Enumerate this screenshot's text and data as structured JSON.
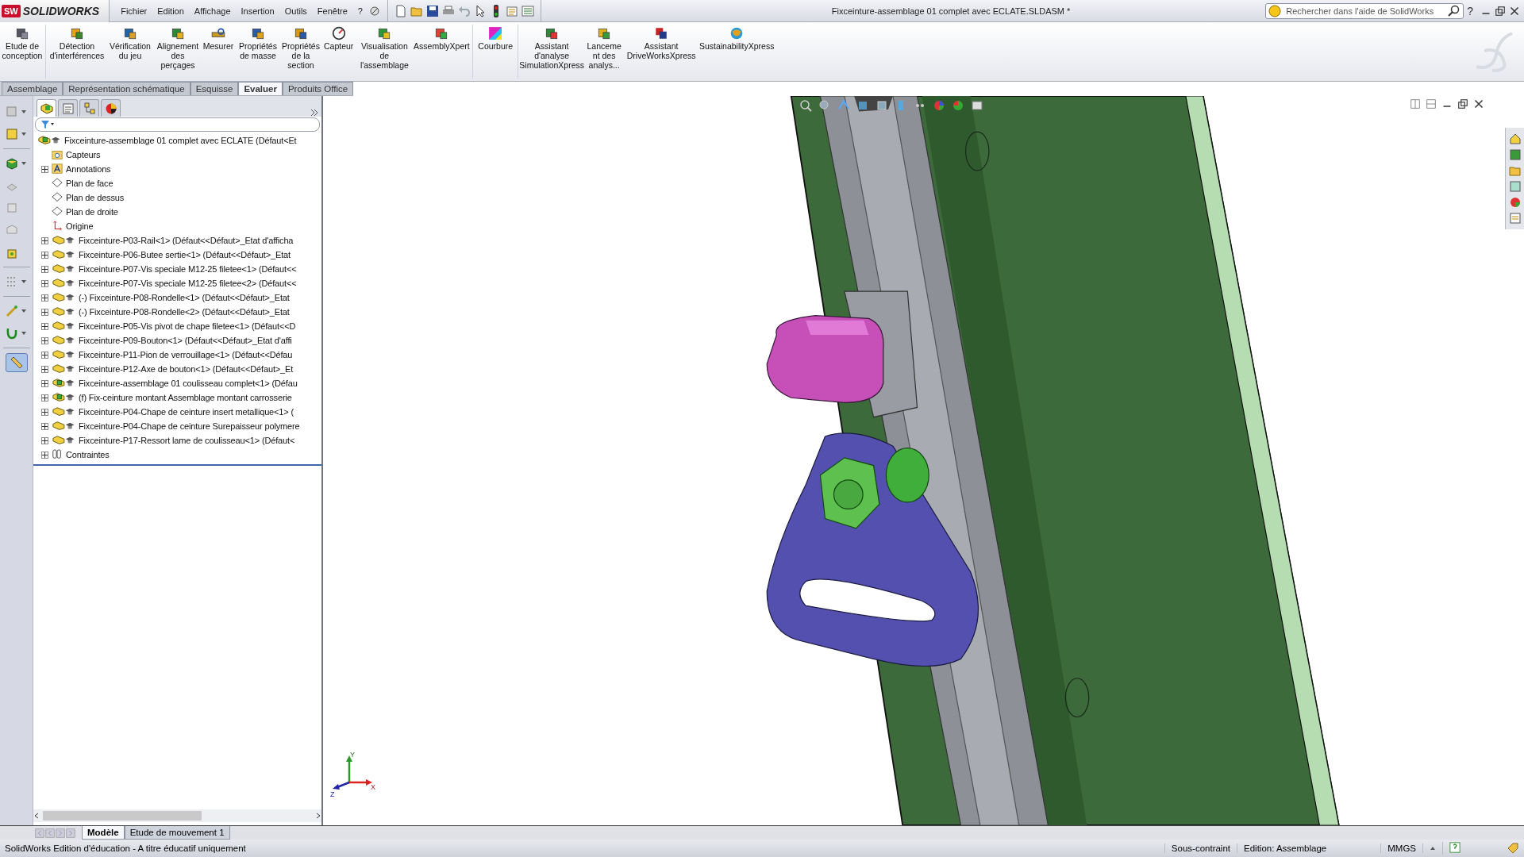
{
  "title_bar": {
    "logo_mark": "SW",
    "logo": "SOLIDWORKS",
    "menu": [
      "Fichier",
      "Edition",
      "Affichage",
      "Insertion",
      "Outils",
      "Fenêtre",
      "?"
    ],
    "document_title": "Fixceinture-assemblage 01 complet avec ECLATE.SLDASM *",
    "search": {
      "placeholder": "Rechercher dans l'aide de SolidWorks"
    },
    "help": "?"
  },
  "command_manager": [
    {
      "label": "Etude de conception",
      "kind": "design"
    },
    {
      "label": "Détection d'interférences",
      "kind": "interference"
    },
    {
      "label": "Vérification du jeu",
      "kind": "clearance"
    },
    {
      "label": "Alignement des perçages",
      "kind": "holes"
    },
    {
      "label": "Mesurer",
      "kind": "measure"
    },
    {
      "label": "Propriétés de masse",
      "kind": "mass"
    },
    {
      "label": "Propriétés de la section",
      "kind": "section"
    },
    {
      "label": "Capteur",
      "kind": "sensor"
    },
    {
      "label": "Visualisation de l'assemblage",
      "kind": "visualize"
    },
    {
      "label": "AssemblyXpert",
      "kind": "xpert"
    },
    {
      "label": "Courbure",
      "kind": "curvature"
    },
    {
      "label": "Assistant d'analyse SimulationXpress",
      "kind": "simulation"
    },
    {
      "label": "Lanceme nt des analys...",
      "kind": "launch"
    },
    {
      "label": "Assistant DriveWorksXpress",
      "kind": "driveworks"
    },
    {
      "label": "SustainabilityXpress",
      "kind": "sustainability"
    }
  ],
  "tabs": [
    {
      "label": "Assemblage",
      "selected": false
    },
    {
      "label": "Représentation schématique",
      "selected": false
    },
    {
      "label": "Esquisse",
      "selected": false
    },
    {
      "label": "Evaluer",
      "selected": true
    },
    {
      "label": "Produits Office",
      "selected": false
    }
  ],
  "feature_tree": {
    "root": {
      "label": "Fixceinture-assemblage 01 complet avec ECLATE  (Défaut<Et",
      "children": [
        {
          "label": "Capteurs",
          "kind": "sensors"
        },
        {
          "label": "Annotations",
          "kind": "annotations"
        },
        {
          "label": "Plan de face",
          "kind": "plane"
        },
        {
          "label": "Plan de dessus",
          "kind": "plane"
        },
        {
          "label": "Plan de droite",
          "kind": "plane"
        },
        {
          "label": "Origine",
          "kind": "origin"
        },
        {
          "label": "Fixceinture-P03-Rail<1> (Défaut<<Défaut>_Etat d'afficha",
          "kind": "part"
        },
        {
          "label": "Fixceinture-P06-Butee sertie<1> (Défaut<<Défaut>_Etat",
          "kind": "part"
        },
        {
          "label": "Fixceinture-P07-Vis speciale M12-25 filetee<1> (Défaut<<",
          "kind": "part"
        },
        {
          "label": "Fixceinture-P07-Vis speciale M12-25 filetee<2> (Défaut<<",
          "kind": "part"
        },
        {
          "label": "(-) Fixceinture-P08-Rondelle<1> (Défaut<<Défaut>_Etat",
          "kind": "part"
        },
        {
          "label": "(-) Fixceinture-P08-Rondelle<2> (Défaut<<Défaut>_Etat",
          "kind": "part"
        },
        {
          "label": "Fixceinture-P05-Vis pivot de chape filetee<1> (Défaut<<D",
          "kind": "part"
        },
        {
          "label": "Fixceinture-P09-Bouton<1> (Défaut<<Défaut>_Etat d'affi",
          "kind": "part"
        },
        {
          "label": "Fixceinture-P11-Pion de verrouillage<1> (Défaut<<Défau",
          "kind": "part"
        },
        {
          "label": "Fixceinture-P12-Axe de bouton<1> (Défaut<<Défaut>_Et",
          "kind": "part"
        },
        {
          "label": "Fixceinture-assemblage 01 coulisseau complet<1> (Défau",
          "kind": "assembly"
        },
        {
          "label": "(f) Fix-ceinture montant Assemblage montant carrosserie",
          "kind": "assembly"
        },
        {
          "label": "Fixceinture-P04-Chape de ceinture insert metallique<1> (",
          "kind": "part"
        },
        {
          "label": "Fixceinture-P04-Chape de ceinture Surepaisseur polymere",
          "kind": "part"
        },
        {
          "label": "Fixceinture-P17-Ressort lame de coulisseau<1> (Défaut<",
          "kind": "part"
        },
        {
          "label": "Contraintes",
          "kind": "mates"
        }
      ]
    }
  },
  "triad": {
    "x": "X",
    "y": "Y",
    "z": "Z"
  },
  "bottom_tabs": [
    {
      "label": "Modèle",
      "selected": true
    },
    {
      "label": "Etude de mouvement 1",
      "selected": false
    }
  ],
  "status_bar": {
    "message": "SolidWorks Edition d'éducation - A titre éducatif uniquement",
    "state": "Sous-contraint",
    "mode": "Edition: Assemblage",
    "units": "MMGS"
  }
}
